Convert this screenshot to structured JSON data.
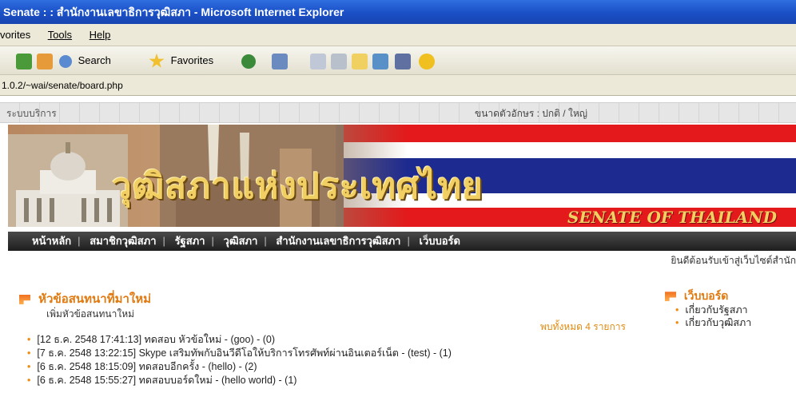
{
  "window": {
    "title": "Senate : : สำนักงานเลขาธิการวุฒิสภา - Microsoft Internet Explorer"
  },
  "menu": {
    "items": [
      "vorites",
      "Tools",
      "Help"
    ]
  },
  "toolbar": {
    "search_label": "Search",
    "favorites_label": "Favorites"
  },
  "address": {
    "url": "1.0.2/~wai/senate/board.php"
  },
  "service_bar": {
    "services_label": "ระบบบริการ",
    "font_size_label": "ขนาดตัวอักษร : ปกติ / ใหญ่"
  },
  "banner": {
    "title": "วุฒิสภาแห่งประเทศไทย",
    "subtitle": "SENATE OF THAILAND"
  },
  "nav": {
    "items": [
      "หน้าหลัก",
      "สมาชิกวุฒิสภา",
      "รัฐสภา",
      "วุฒิสภา",
      "สำนักงานเลขาธิการวุฒิสภา",
      "เว็บบอร์ด"
    ]
  },
  "welcome_text": "ยินดีต้อนรับเข้าสู่เว็บไซต์สำนัก",
  "board": {
    "title": "หัวข้อสนทนาที่มาใหม่",
    "new_topic_link": "เพิ่มหัวข้อสนทนาใหม่",
    "count_text": "พบทั้งหมด 4 รายการ",
    "topics": [
      "[12 ธ.ค. 2548 17:41:13] ทดสอบ หัวข้อใหม่ - (goo) - (0)",
      "[7 ธ.ค. 2548 13:22:15] Skype เสริมทัพกับอินวีดีโอให้บริการโทรศัพท์ผ่านอินเตอร์เน็ต - (test) - (1)",
      "[6 ธ.ค. 2548 18:15:09] ทดสอบอีกครั้ง - (hello) - (2)",
      "[6 ธ.ค. 2548 15:55:27] ทดสอบบอร์ดใหม่ - (hello world) - (1)"
    ]
  },
  "sidebar": {
    "title": "เว็บบอร์ด",
    "links": [
      "เกี่ยวกับรัฐสภา",
      "เกี่ยวกับวุฒิสภา"
    ]
  }
}
